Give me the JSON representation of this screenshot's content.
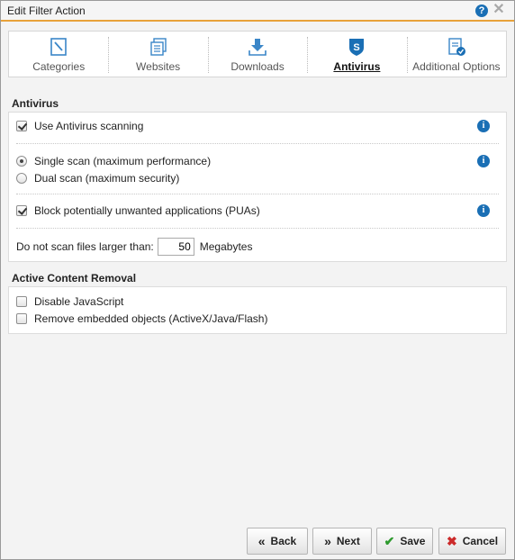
{
  "window": {
    "title": "Edit Filter Action"
  },
  "tabs": [
    {
      "label": "Categories",
      "icon": "categories-icon",
      "active": false
    },
    {
      "label": "Websites",
      "icon": "websites-icon",
      "active": false
    },
    {
      "label": "Downloads",
      "icon": "downloads-icon",
      "active": false
    },
    {
      "label": "Antivirus",
      "icon": "antivirus-shield-icon",
      "active": true
    },
    {
      "label": "Additional Options",
      "icon": "additional-options-icon",
      "active": false
    }
  ],
  "antivirus": {
    "section_title": "Antivirus",
    "use_scanning": {
      "label": "Use Antivirus scanning",
      "checked": true
    },
    "single_scan": {
      "label": "Single scan (maximum performance)",
      "selected": true
    },
    "dual_scan": {
      "label": "Dual scan (maximum security)",
      "selected": false
    },
    "block_pua": {
      "label": "Block potentially unwanted applications (PUAs)",
      "checked": true
    },
    "max_size": {
      "label": "Do not scan files larger than:",
      "value": "50",
      "unit": "Megabytes"
    }
  },
  "active_content": {
    "section_title": "Active Content Removal",
    "disable_js": {
      "label": "Disable JavaScript",
      "checked": false
    },
    "remove_embedded": {
      "label": "Remove embedded objects (ActiveX/Java/Flash)",
      "checked": false
    }
  },
  "footer": {
    "back": "Back",
    "next": "Next",
    "save": "Save",
    "cancel": "Cancel"
  },
  "colors": {
    "accent_orange": "#e8a23a",
    "icon_blue": "#1a6fb5",
    "save_green": "#2e9a2e",
    "cancel_red": "#cc2a2a"
  }
}
